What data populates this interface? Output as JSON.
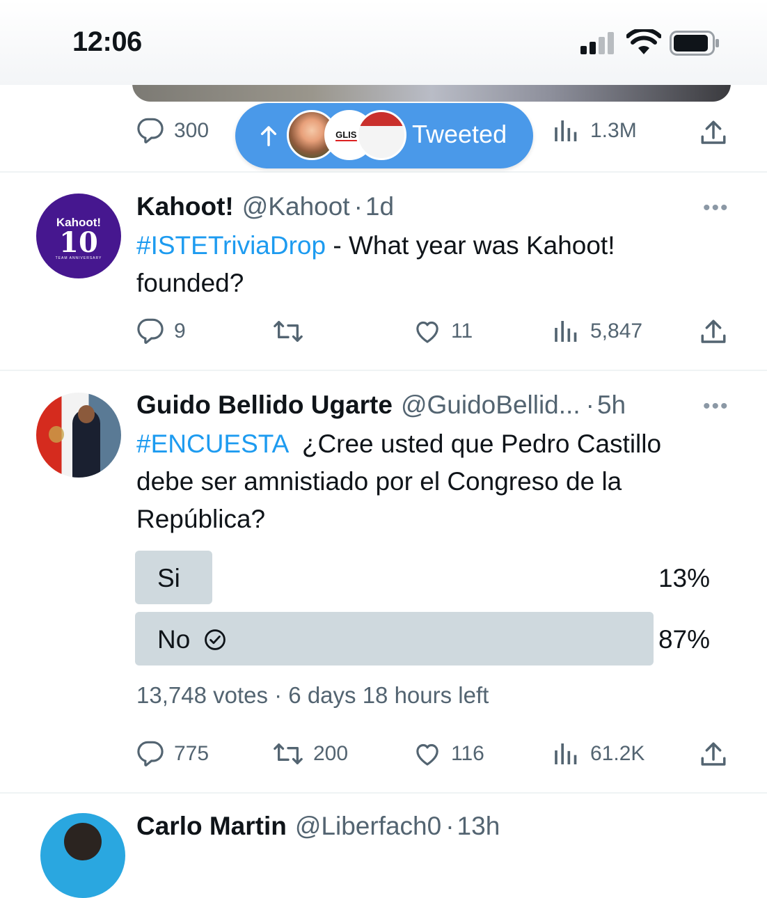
{
  "status": {
    "time": "12:06"
  },
  "prev_tweet": {
    "replies": "300",
    "views": "1.3M"
  },
  "tweeted_pill": {
    "label": "Tweeted"
  },
  "tweets": [
    {
      "name": "Kahoot!",
      "handle": "@Kahoot",
      "sep": "·",
      "time": "1d",
      "hashtag": "#ISTETriviaDrop",
      "text": " - What year was Kahoot! founded?",
      "replies": "9",
      "retweets": "",
      "likes": "11",
      "views": "5,847",
      "avatar_text": "Kahoot!",
      "avatar_num": "10",
      "avatar_caption": "TEAM ANNIVERSARY"
    },
    {
      "name": "Guido Bellido Ugarte",
      "handle": "@GuidoBellid...",
      "sep": "·",
      "time": "5h",
      "hashtag": "#ENCUESTA",
      "text": "  ¿Cree usted que Pedro Castillo debe ser amnistiado por el Congreso de la República?",
      "poll": {
        "options": [
          {
            "label": "Si",
            "pct": "13%",
            "value": 13
          },
          {
            "label": "No",
            "pct": "87%",
            "value": 87,
            "selected": true
          }
        ],
        "summary": "13,748 votes · 6 days 18 hours left"
      },
      "replies": "775",
      "retweets": "200",
      "likes": "116",
      "views": "61.2K"
    },
    {
      "name": "Carlo Martin",
      "handle": "@Liberfach0",
      "sep": "·",
      "time": "13h"
    }
  ],
  "icons": {
    "reply": "reply-icon",
    "retweet": "retweet-icon",
    "like": "like-icon",
    "views": "views-icon",
    "share": "share-icon",
    "more": "more-icon",
    "check": "check-circle-icon",
    "arrow": "arrow-up-icon"
  },
  "colors": {
    "accent": "#1d9bf0",
    "pill": "#4a99e9",
    "poll_bar": "#cfd9de",
    "muted": "#536471"
  }
}
